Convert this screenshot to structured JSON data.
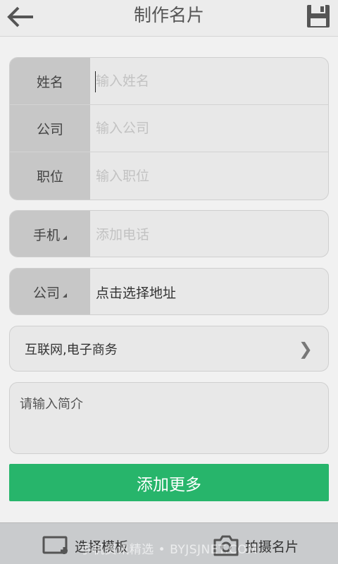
{
  "header": {
    "title": "制作名片",
    "back_icon": "arrow-left-icon",
    "save_icon": "floppy-disk-icon"
  },
  "form_group_main": {
    "rows": [
      {
        "label": "姓名",
        "placeholder": "输入姓名"
      },
      {
        "label": "公司",
        "placeholder": "输入公司"
      },
      {
        "label": "职位",
        "placeholder": "输入职位"
      }
    ]
  },
  "phone_row": {
    "label": "手机",
    "placeholder": "添加电话"
  },
  "address_row": {
    "label": "公司",
    "value": "点击选择地址"
  },
  "industry": {
    "value": "互联网,电子商务",
    "chevron": "❯"
  },
  "intro": {
    "placeholder": "请输入简介"
  },
  "add_more_label": "添加更多",
  "bottom_bar": {
    "template_label": "选择模板",
    "template_icon": "template-add-icon",
    "shoot_label": "拍摄名片",
    "shoot_icon": "camera-icon"
  },
  "watermark": "手机资讯精选 • BYJSJNET.COM",
  "colors": {
    "accent": "#27b56b",
    "label_bg": "#c7c7c7",
    "field_bg": "#e8e8e8",
    "page_bg": "#f1f1f1",
    "bottom_bar_bg": "#c9cbcd"
  }
}
